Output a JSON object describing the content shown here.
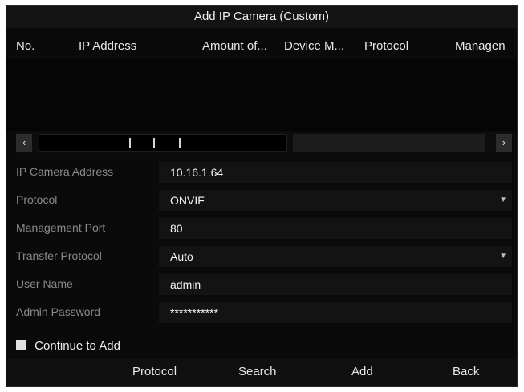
{
  "window": {
    "title": "Add IP Camera (Custom)"
  },
  "table": {
    "columns": [
      "No.",
      "IP Address",
      "Amount of...",
      "Device M...",
      "Protocol",
      "Managen"
    ],
    "rows": []
  },
  "form": {
    "ip_camera_address": {
      "label": "IP Camera Address",
      "value": "10.16.1.64"
    },
    "protocol": {
      "label": "Protocol",
      "value": "ONVIF"
    },
    "management_port": {
      "label": "Management Port",
      "value": "80"
    },
    "transfer_protocol": {
      "label": "Transfer Protocol",
      "value": "Auto"
    },
    "user_name": {
      "label": "User Name",
      "value": "admin"
    },
    "admin_password": {
      "label": "Admin Password",
      "value": "***********"
    }
  },
  "continue_to_add": {
    "label": "Continue to Add",
    "checked": true
  },
  "footer": {
    "protocol": "Protocol",
    "search": "Search",
    "add": "Add",
    "back": "Back"
  },
  "icons": {
    "scroll_left": "chevron-left-icon",
    "scroll_right": "chevron-right-icon",
    "dropdown": "caret-down-icon"
  },
  "colors": {
    "background": "#0a0a0a",
    "field": "#131313",
    "label_text": "#8a8a8a",
    "value_text": "#f2f2f2"
  }
}
